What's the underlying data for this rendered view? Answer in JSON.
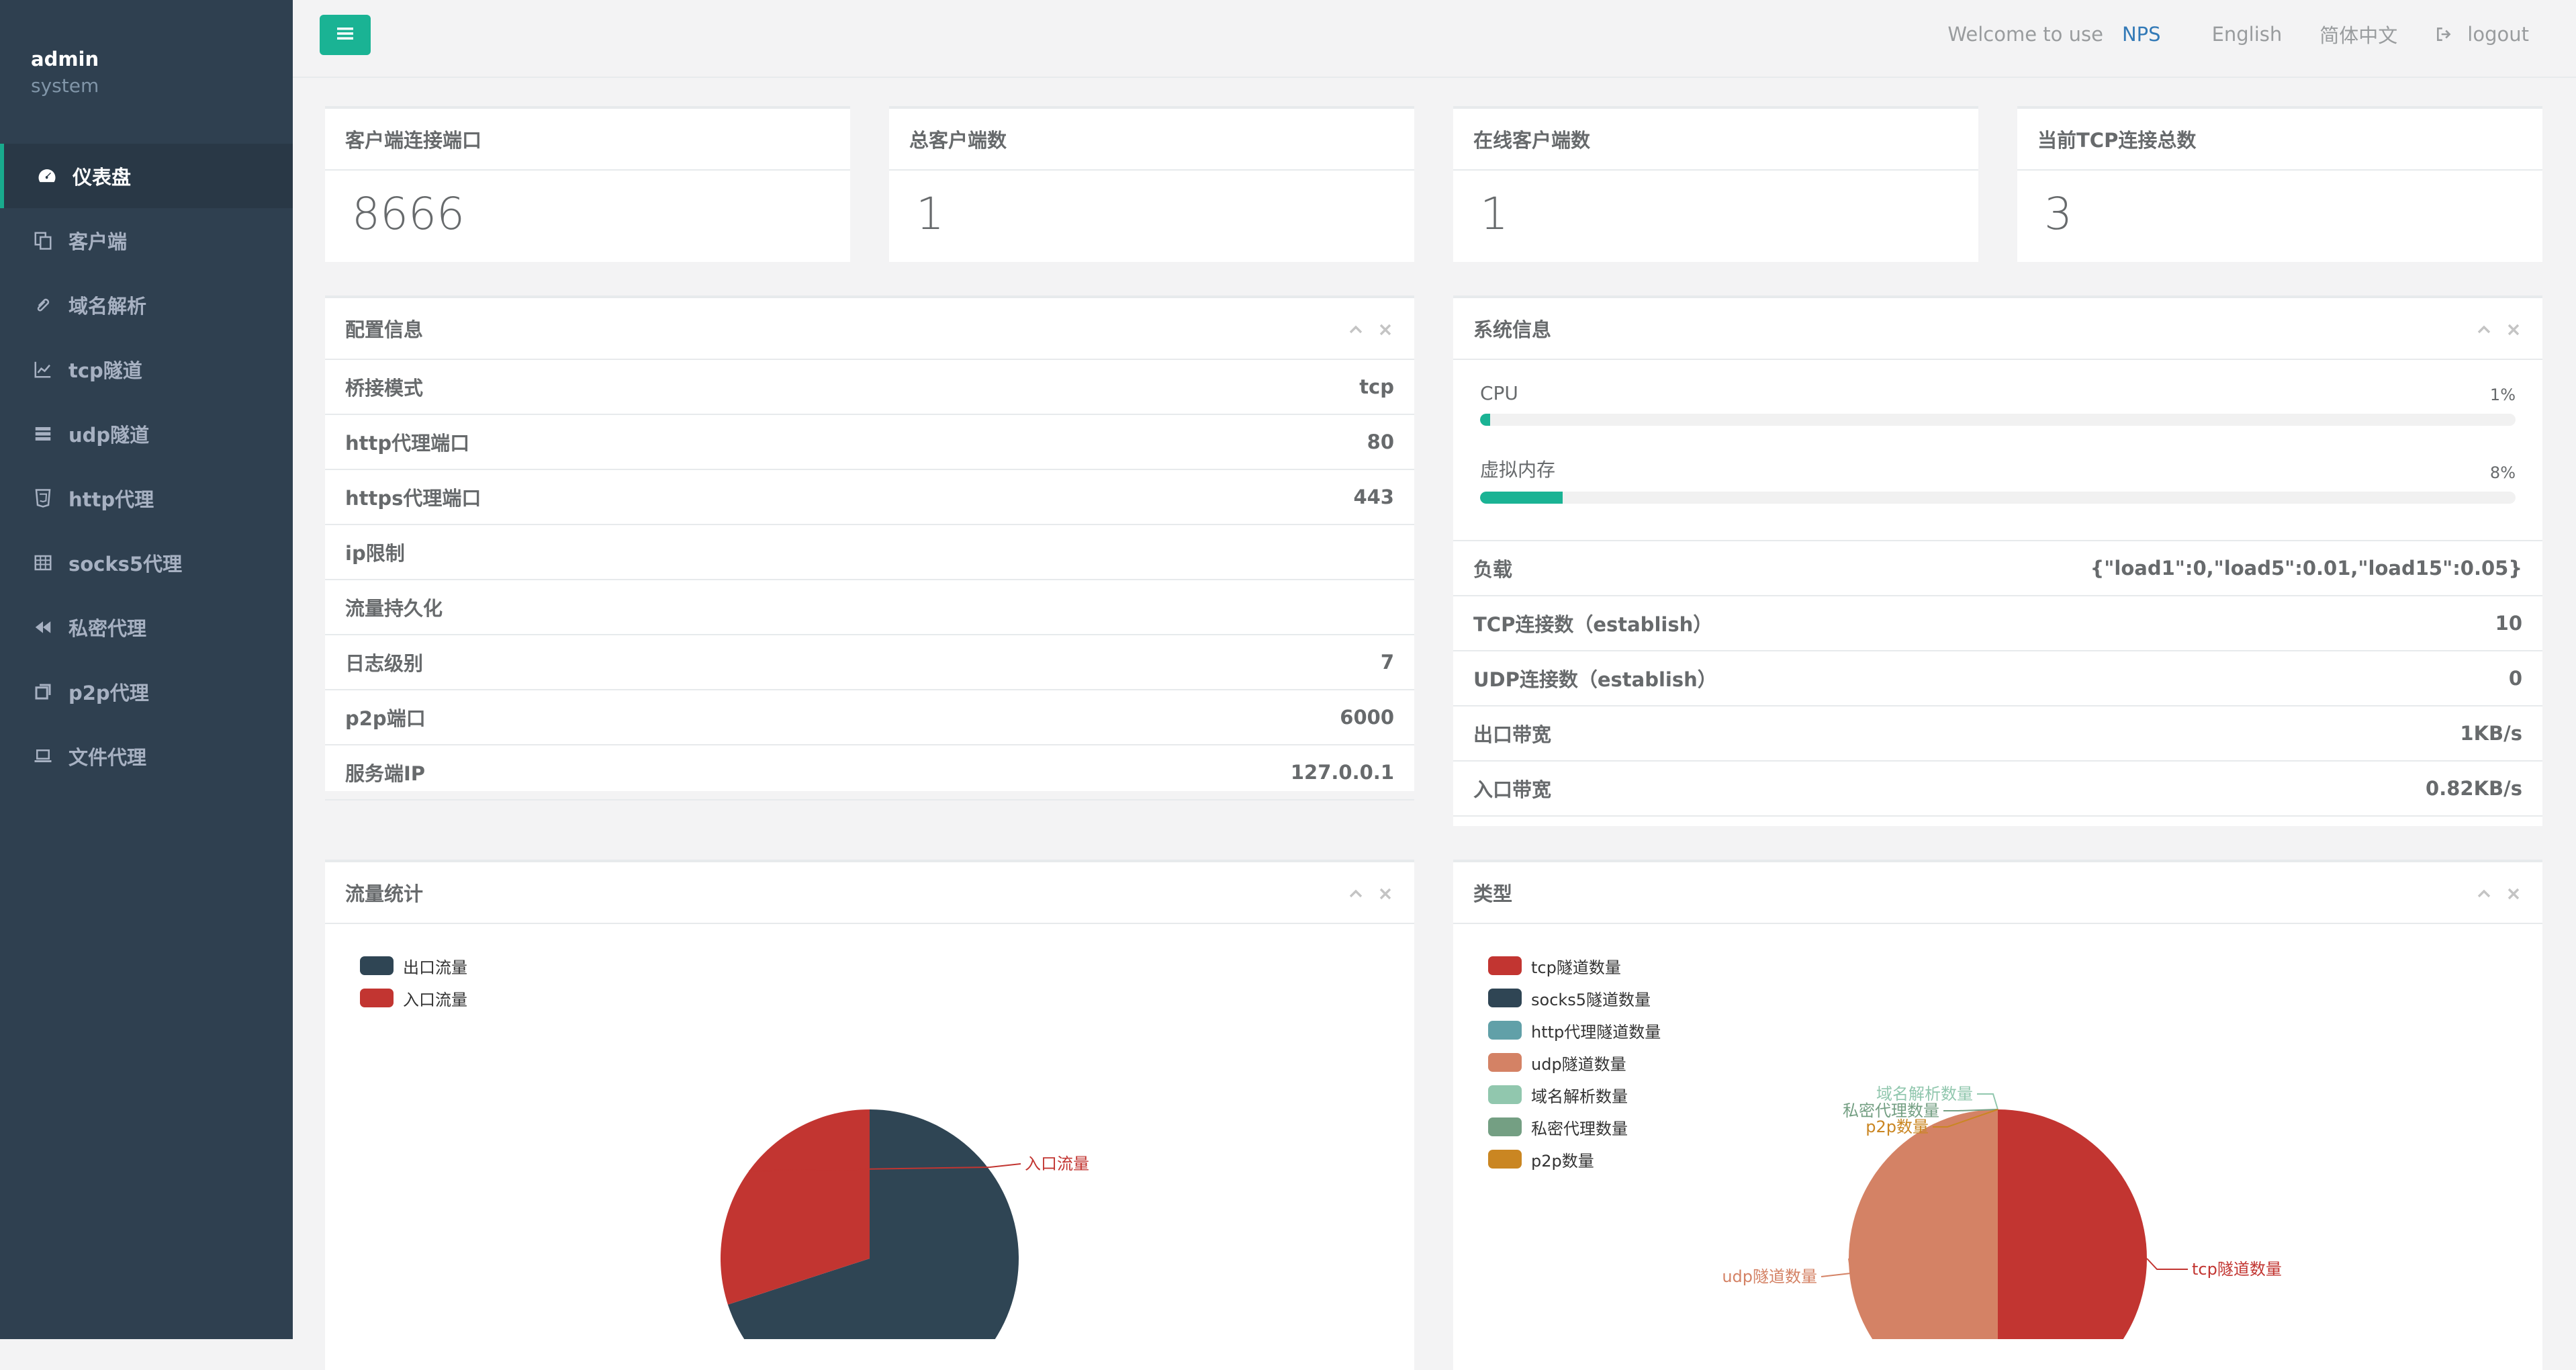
{
  "user": {
    "name": "admin",
    "role": "system"
  },
  "nav": [
    {
      "label": "仪表盘",
      "icon": "dashboard-icon",
      "active": true
    },
    {
      "label": "客户端",
      "icon": "copy-icon"
    },
    {
      "label": "域名解析",
      "icon": "paperclip-icon"
    },
    {
      "label": "tcp隧道",
      "icon": "line-chart-icon"
    },
    {
      "label": "udp隧道",
      "icon": "server-icon"
    },
    {
      "label": "http代理",
      "icon": "html5-icon"
    },
    {
      "label": "socks5代理",
      "icon": "table-icon"
    },
    {
      "label": "私密代理",
      "icon": "backward-icon"
    },
    {
      "label": "p2p代理",
      "icon": "clone-icon"
    },
    {
      "label": "文件代理",
      "icon": "laptop-icon"
    }
  ],
  "topbar": {
    "welcome": "Welcome to use",
    "brand": "NPS",
    "lang_en": "English",
    "lang_zh": "简体中文",
    "logout": "logout"
  },
  "stats": [
    {
      "title": "客户端连接端口",
      "value": "8666"
    },
    {
      "title": "总客户端数",
      "value": "1"
    },
    {
      "title": "在线客户端数",
      "value": "1"
    },
    {
      "title": "当前TCP连接总数",
      "value": "3"
    }
  ],
  "config": {
    "title": "配置信息",
    "rows": [
      {
        "label": "桥接模式",
        "value": "tcp"
      },
      {
        "label": "http代理端口",
        "value": "80"
      },
      {
        "label": "https代理端口",
        "value": "443"
      },
      {
        "label": "ip限制",
        "value": ""
      },
      {
        "label": "流量持久化",
        "value": ""
      },
      {
        "label": "日志级别",
        "value": "7"
      },
      {
        "label": "p2p端口",
        "value": "6000"
      },
      {
        "label": "服务端IP",
        "value": "127.0.0.1"
      }
    ]
  },
  "system": {
    "title": "系统信息",
    "cpu_label": "CPU",
    "cpu_pct": "1%",
    "cpu_value": 1,
    "mem_label": "虚拟内存",
    "mem_pct": "8%",
    "mem_value": 8,
    "rows": [
      {
        "label": "负载",
        "value": "{\"load1\":0,\"load5\":0.01,\"load15\":0.05}"
      },
      {
        "label": "TCP连接数（establish）",
        "value": "10"
      },
      {
        "label": "UDP连接数（establish）",
        "value": "0"
      },
      {
        "label": "出口带宽",
        "value": "1KB/s"
      },
      {
        "label": "入口带宽",
        "value": "0.82KB/s"
      }
    ]
  },
  "traffic": {
    "title": "流量统计",
    "legend": [
      {
        "name": "出口流量",
        "color": "#2f4554"
      },
      {
        "name": "入口流量",
        "color": "#c23531"
      }
    ]
  },
  "types": {
    "title": "类型",
    "legend": [
      {
        "name": "tcp隧道数量",
        "color": "#c23531"
      },
      {
        "name": "socks5隧道数量",
        "color": "#2f4554"
      },
      {
        "name": "http代理隧道数量",
        "color": "#61a0a8"
      },
      {
        "name": "udp隧道数量",
        "color": "#d48265"
      },
      {
        "name": "域名解析数量",
        "color": "#91c7ae"
      },
      {
        "name": "私密代理数量",
        "color": "#749f83"
      },
      {
        "name": "p2p数量",
        "color": "#ca8622"
      }
    ]
  },
  "chart_data": [
    {
      "type": "pie",
      "title": "流量统计",
      "series": [
        {
          "name": "",
          "values": [
            70,
            30
          ]
        }
      ],
      "categories": [
        "出口流量",
        "入口流量"
      ],
      "labels_shown": [
        "入口流量"
      ],
      "colors": [
        "#2f4554",
        "#c23531"
      ]
    },
    {
      "type": "pie",
      "title": "类型",
      "categories": [
        "tcp隧道数量",
        "socks5隧道数量",
        "http代理隧道数量",
        "udp隧道数量",
        "域名解析数量",
        "私密代理数量",
        "p2p数量"
      ],
      "series": [
        {
          "name": "",
          "values": [
            1,
            0,
            0,
            1,
            0,
            0,
            0
          ]
        }
      ],
      "labels_shown": [
        "tcp隧道数量",
        "udp隧道数量",
        "域名解析数量",
        "私密代理数量",
        "p2p数量"
      ],
      "colors": [
        "#c23531",
        "#2f4554",
        "#61a0a8",
        "#d48265",
        "#91c7ae",
        "#749f83",
        "#ca8622"
      ]
    }
  ]
}
